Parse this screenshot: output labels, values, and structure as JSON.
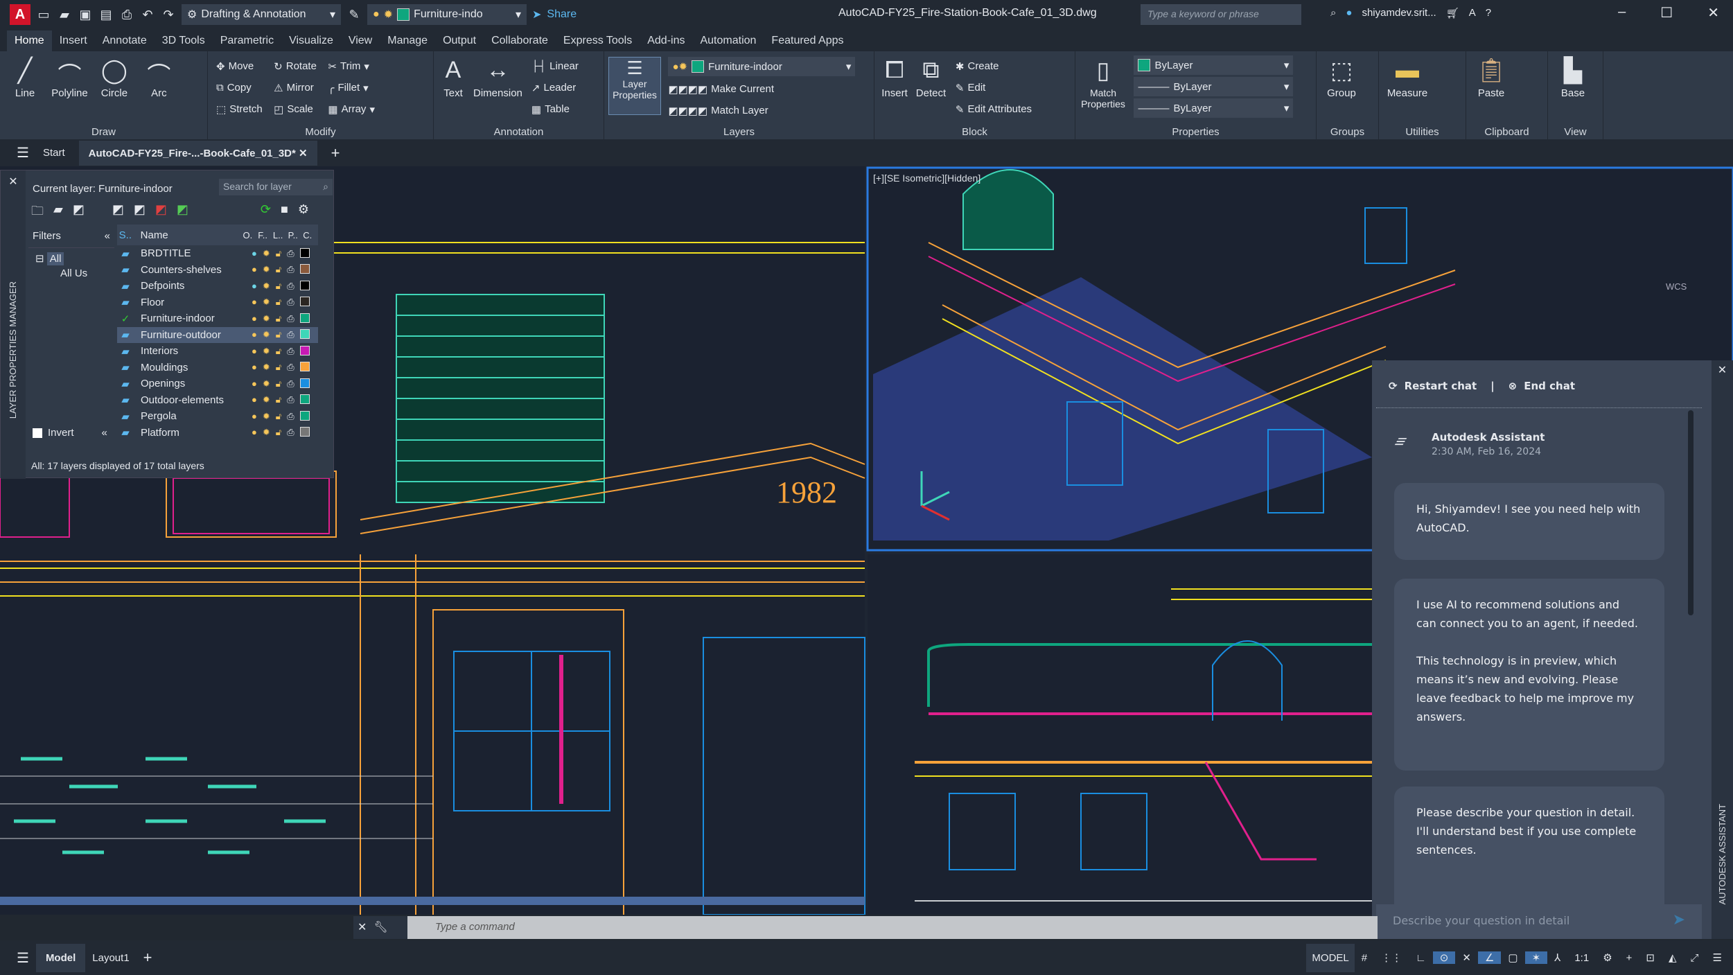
{
  "titlebar": {
    "app_logo": "A",
    "workspace": "Drafting & Annotation",
    "layer_combo": "Furniture-indo",
    "share": "Share",
    "file_title": "AutoCAD-FY25_Fire-Station-Book-Cafe_01_3D.dwg",
    "search_placeholder": "Type a keyword or phrase",
    "user": "shiyamdev.srit..."
  },
  "ribbon_tabs": [
    "Home",
    "Insert",
    "Annotate",
    "3D Tools",
    "Parametric",
    "Visualize",
    "View",
    "Manage",
    "Output",
    "Collaborate",
    "Express Tools",
    "Add-ins",
    "Automation",
    "Featured Apps"
  ],
  "ribbon": {
    "draw": {
      "title": "Draw",
      "line": "Line",
      "polyline": "Polyline",
      "circle": "Circle",
      "arc": "Arc"
    },
    "modify": {
      "title": "Modify",
      "move": "Move",
      "rotate": "Rotate",
      "trim": "Trim",
      "copy": "Copy",
      "mirror": "Mirror",
      "fillet": "Fillet",
      "stretch": "Stretch",
      "scale": "Scale",
      "array": "Array"
    },
    "annotation": {
      "title": "Annotation",
      "text": "Text",
      "dimension": "Dimension",
      "linear": "Linear",
      "leader": "Leader",
      "table": "Table"
    },
    "layers": {
      "title": "Layers",
      "layer_properties": "Layer Properties",
      "current_layer": "Furniture-indoor",
      "make_current": "Make Current",
      "match_layer": "Match Layer"
    },
    "block": {
      "title": "Block",
      "insert": "Insert",
      "detect": "Detect",
      "create": "Create",
      "edit": "Edit",
      "edit_attributes": "Edit Attributes"
    },
    "properties": {
      "title": "Properties",
      "match_properties": "Match Properties",
      "color": "ByLayer",
      "linetype": "ByLayer",
      "lineweight": "ByLayer"
    },
    "groups": {
      "title": "Groups",
      "group": "Group"
    },
    "utilities": {
      "title": "Utilities",
      "measure": "Measure"
    },
    "clipboard": {
      "title": "Clipboard",
      "paste": "Paste"
    },
    "view": {
      "title": "View",
      "base": "Base"
    }
  },
  "doc_tabs": {
    "start": "Start",
    "active": "AutoCAD-FY25_Fire-...-Book-Cafe_01_3D*"
  },
  "layer_manager": {
    "panel_title": "LAYER PROPERTIES MANAGER",
    "current": "Current layer: Furniture-indoor",
    "search_placeholder": "Search for layer",
    "filters": "Filters",
    "filter_all": "All",
    "filter_all_used": "All Us",
    "invert": "Invert",
    "headers": {
      "status": "S..",
      "name": "Name",
      "on": "O.",
      "freeze": "F..",
      "lock": "L..",
      "plot": "P..",
      "color": "C."
    },
    "layers": [
      {
        "name": "BRDTITLE",
        "color": "#000000",
        "on": "#6cd4e6"
      },
      {
        "name": "Counters-shelves",
        "color": "#8a5a3c",
        "on": "#f6c65a"
      },
      {
        "name": "Defpoints",
        "color": "#000000",
        "on": "#6cd4e6"
      },
      {
        "name": "Floor",
        "color": "#2b2622",
        "on": "#f6c65a"
      },
      {
        "name": "Furniture-indoor",
        "color": "#0ea67e",
        "on": "#f6c65a",
        "current": true
      },
      {
        "name": "Furniture-outdoor",
        "color": "#3fd6b8",
        "on": "#f6c65a",
        "selected": true
      },
      {
        "name": "Interiors",
        "color": "#c81ab4",
        "on": "#f6c65a"
      },
      {
        "name": "Mouldings",
        "color": "#f7a23a",
        "on": "#f6c65a"
      },
      {
        "name": "Openings",
        "color": "#1a8ee0",
        "on": "#f6c65a"
      },
      {
        "name": "Outdoor-elements",
        "color": "#0ea67e",
        "on": "#f6c65a"
      },
      {
        "name": "Pergola",
        "color": "#0ea67e",
        "on": "#f6c65a"
      },
      {
        "name": "Platform",
        "color": "#777777",
        "on": "#f6c65a"
      }
    ],
    "footer": "All: 17 layers displayed of 17 total layers"
  },
  "viewport": {
    "iso_label": "[+][SE Isometric][Hidden]",
    "wcs": "WCS",
    "year_text": "1982"
  },
  "assistant": {
    "side_title": "AUTODESK ASSISTANT",
    "restart": "Restart chat",
    "end": "End chat",
    "name": "Autodesk Assistant",
    "timestamp": "2:30 AM, Feb 16, 2024",
    "messages": [
      "Hi, Shiyamdev! I see you need help with AutoCAD.",
      "I use AI to recommend solutions and can connect you to an agent, if needed.\n\nThis technology is in preview, which means it’s new and evolving. Please leave feedback to help me improve my answers.",
      "Please describe your question in detail. I'll understand best if you use complete sentences."
    ],
    "input_placeholder": "Describe your question in detail"
  },
  "command_line": {
    "placeholder": "Type a command"
  },
  "statusbar": {
    "model_tab": "Model",
    "layout_tab": "Layout1",
    "model_button": "MODEL",
    "scale": "1:1"
  },
  "colors": {
    "accent": "#0696d7",
    "cyan": "#3fd6b8",
    "yellow": "#f0e020",
    "orange": "#f7a23a",
    "magenta": "#e0208c",
    "blue": "#1a8ee0"
  }
}
